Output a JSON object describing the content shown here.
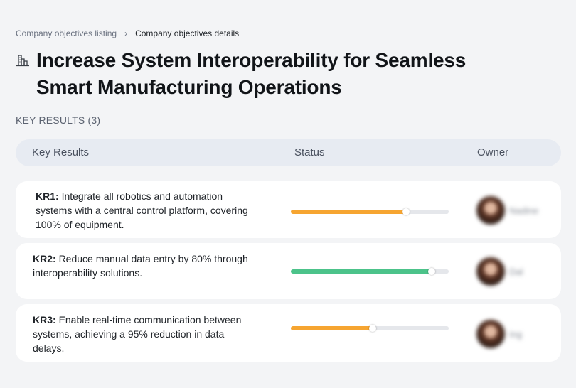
{
  "breadcrumb": {
    "parent": "Company objectives listing",
    "separator": "›",
    "current": "Company objectives details"
  },
  "title": {
    "icon": "building-chart-icon",
    "text": "Increase System Interoperability for Seamless Smart Manufacturing Operations"
  },
  "section": {
    "label": "KEY RESULTS (3)"
  },
  "table": {
    "headers": {
      "key_results": "Key Results",
      "status": "Status",
      "owner": "Owner"
    },
    "rows": [
      {
        "code": "KR1:",
        "text": "Integrate all robotics and automation systems with a central control platform, covering 100% of equipment.",
        "progress": 0.73,
        "color": "#f6a531",
        "owner": "Nadine"
      },
      {
        "code": "KR2:",
        "text": "Reduce manual data entry by 80% through interoperability solutions.",
        "progress": 0.89,
        "color": "#4cc38a",
        "owner": "Dal"
      },
      {
        "code": "KR3:",
        "text": "Enable real-time communication between systems, achieving a 95% reduction in data delays.",
        "progress": 0.52,
        "color": "#f6a531",
        "owner": "Ing"
      }
    ]
  }
}
